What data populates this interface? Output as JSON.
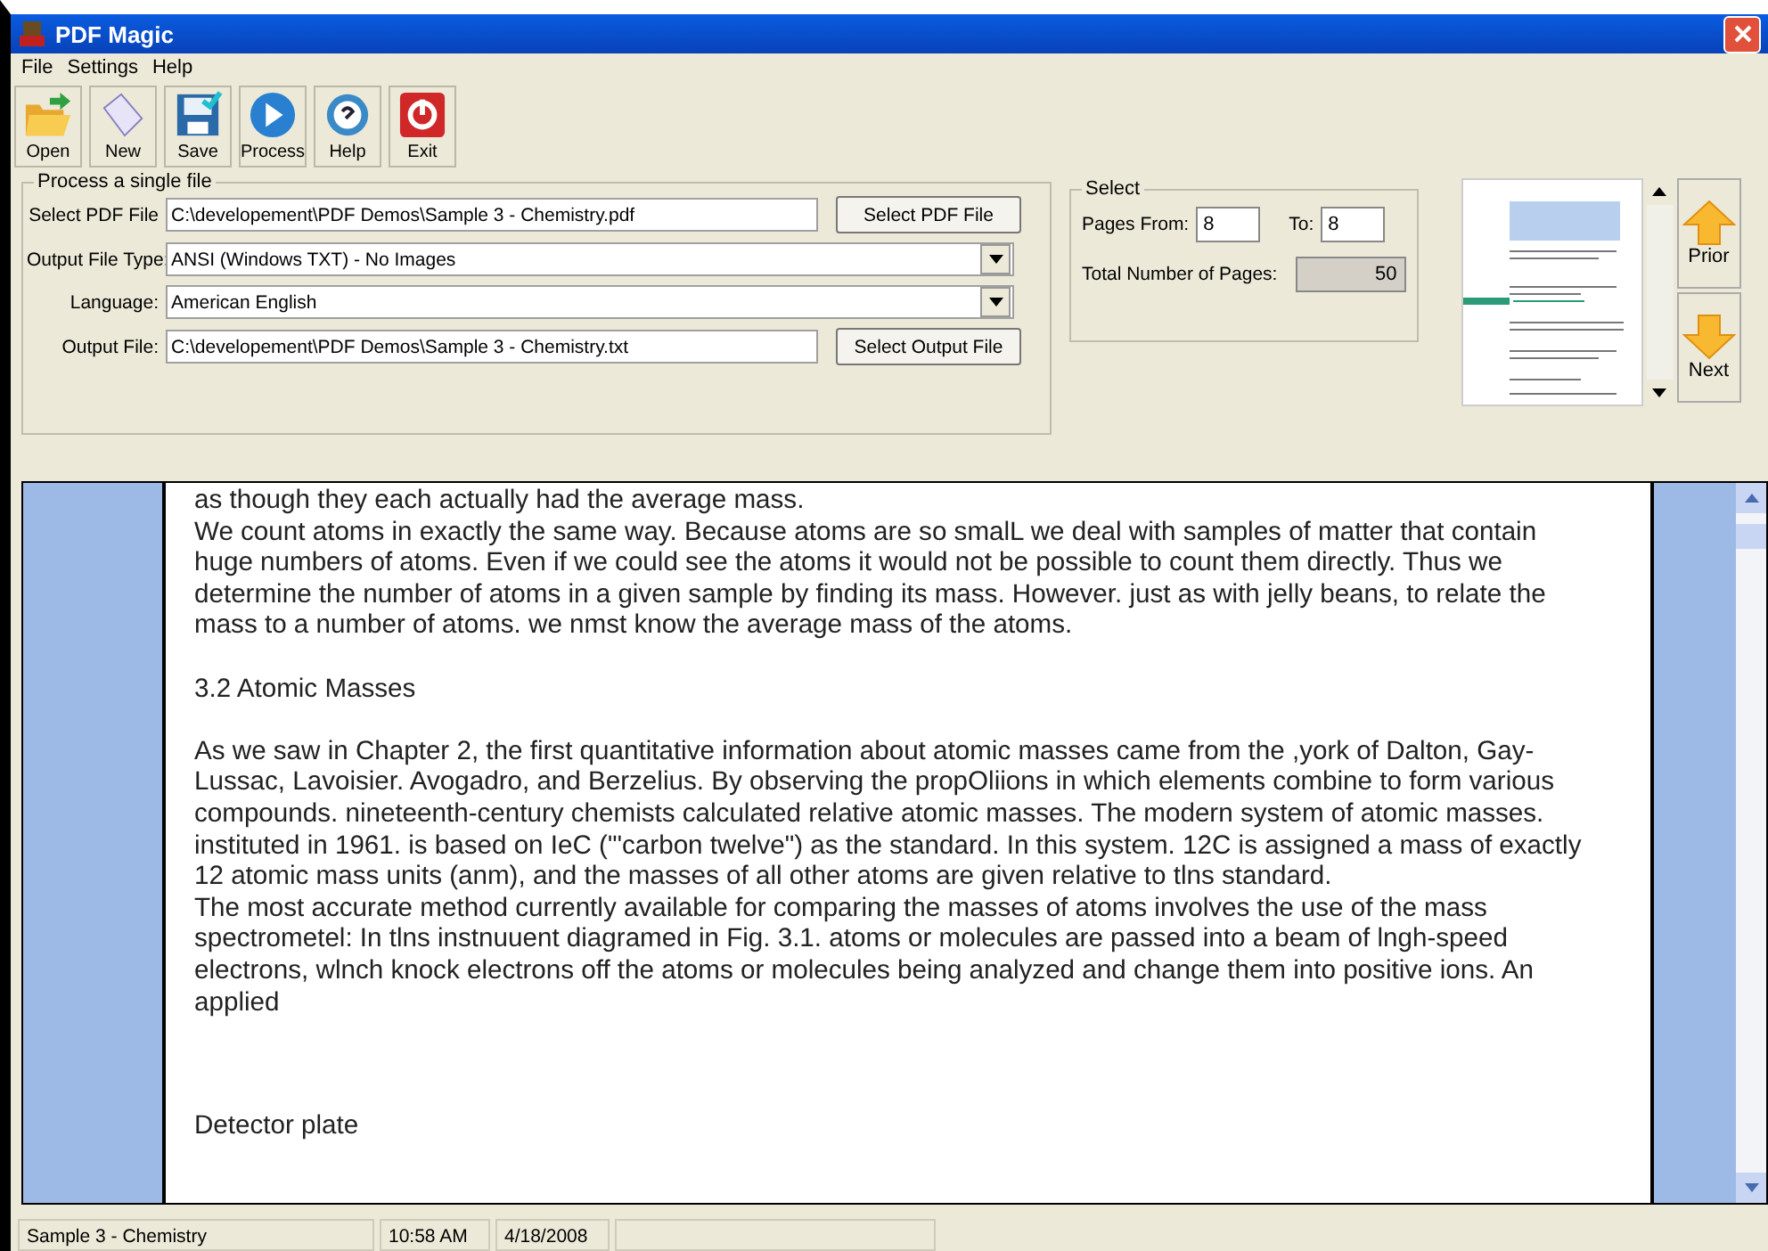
{
  "window": {
    "title": "PDF Magic"
  },
  "menu": [
    "File",
    "Settings",
    "Help"
  ],
  "toolbar": [
    {
      "kind": "open",
      "label": "Open"
    },
    {
      "kind": "new",
      "label": "New"
    },
    {
      "kind": "save",
      "label": "Save"
    },
    {
      "kind": "process",
      "label": "Process"
    },
    {
      "kind": "help",
      "label": "Help"
    },
    {
      "kind": "exit",
      "label": "Exit"
    }
  ],
  "file_group": {
    "title": "Process a single file",
    "rows": [
      {
        "kind": "input",
        "label": "Select PDF File",
        "value": "C:\\developement\\PDF Demos\\Sample 3 - Chemistry.pdf",
        "button": "Select PDF File"
      },
      {
        "kind": "dropdown",
        "label": "Output File Type:",
        "value": "ANSI (Windows TXT)  - No Images"
      },
      {
        "kind": "dropdown",
        "label": "Language:",
        "value": "American English"
      },
      {
        "kind": "input",
        "label": "Output File:",
        "value": "C:\\developement\\PDF Demos\\Sample 3 - Chemistry.txt",
        "button": "Select Output File"
      }
    ]
  },
  "select_group": {
    "title": "Select",
    "from_label": "Pages From:",
    "from": "8",
    "to_label": "To:",
    "to": "8",
    "total_label": "Total Number of Pages:",
    "total": "50"
  },
  "nav_buttons": [
    {
      "kind": "up",
      "label": "Prior"
    },
    {
      "kind": "down",
      "label": "Next"
    }
  ],
  "document": {
    "paragraphs": [
      {
        "kind": "text",
        "text": "as though they each actually had the average mass."
      },
      {
        "kind": "text",
        "text": "We count atoms in exactly the same way. Because atoms are so smalL we deal with samples of matter that contain huge numbers of atoms. Even if we could see the atoms it would not be possible to count them directly. Thus we determine the number of atoms in a given sample by finding its mass. However. just as with jelly beans, to relate the mass to a number of atoms. we nmst know the average mass of the atoms."
      },
      {
        "kind": "heading",
        "text": "3.2 Atomic Masses"
      },
      {
        "kind": "text",
        "text": "As we saw in Chapter 2, the first quantitative information about atomic masses came from the ,york of Dalton, Gay-Lussac, Lavoisier. Avogadro, and Berzelius. By observing the propOliions in which elements combine to form various compounds. nineteenth-century chemists calculated relative atomic masses. The modern system of atomic masses. instituted in 1961. is based on IeC (\"'carbon twelve\") as the standard. In this system. 12C is assigned a mass of exactly 12 atomic mass units (anm), and the masses of all other atoms are given relative to tlns standard."
      },
      {
        "kind": "text",
        "text": "The most accurate method currently available for comparing the masses of atoms involves the use of the mass spectrometel: In tlns instnuuent diagramed in Fig. 3.1. atoms or molecules are passed into a beam of lngh-speed electrons, wlnch knock electrons off the atoms or molecules being analyzed and change them into positive ions. An applied"
      },
      {
        "kind": "caption",
        "text": "Detector plate"
      }
    ]
  },
  "status_bar": [
    "Sample 3 - Chemistry",
    "10:58 AM",
    "4/18/2008"
  ]
}
